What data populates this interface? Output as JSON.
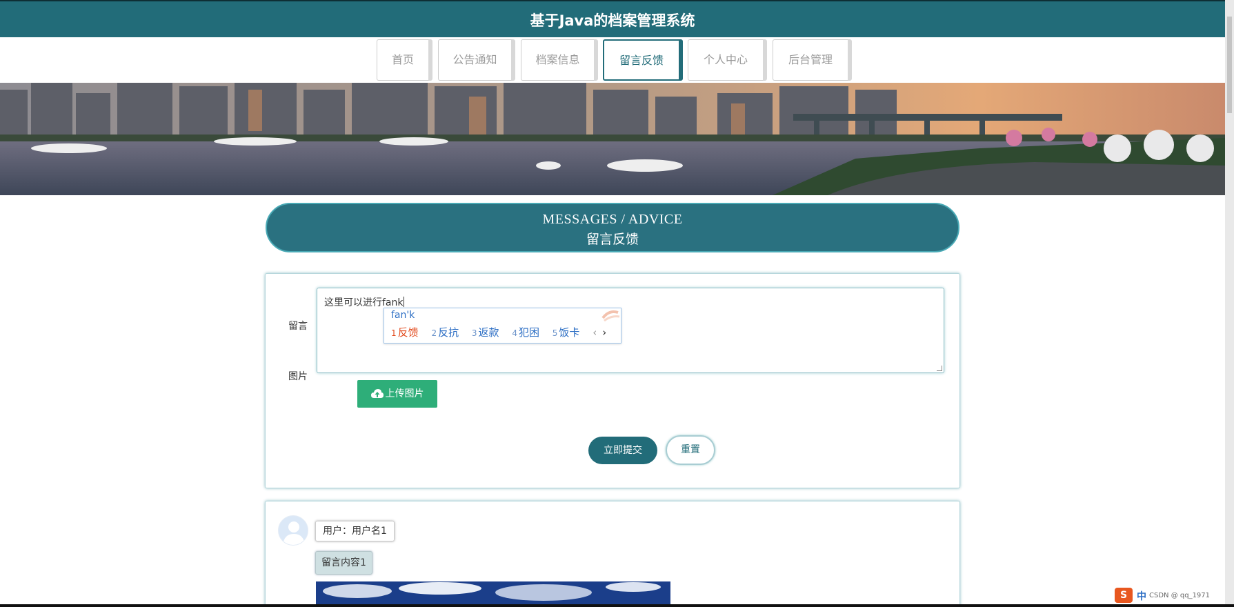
{
  "app_title": "基于Java的档案管理系统",
  "nav": {
    "items": [
      {
        "label": "首页",
        "active": false
      },
      {
        "label": "公告通知",
        "active": false
      },
      {
        "label": "档案信息",
        "active": false
      },
      {
        "label": "留言反馈",
        "active": true
      },
      {
        "label": "个人中心",
        "active": false
      },
      {
        "label": "后台管理",
        "active": false
      }
    ]
  },
  "section": {
    "title_en": "MESSAGES / ADVICE",
    "title_cn": "留言反馈"
  },
  "form": {
    "message_label": "留言",
    "message_value": "这里可以进行fank",
    "image_label": "图片",
    "upload_label": "上传图片",
    "submit_label": "立即提交",
    "reset_label": "重置"
  },
  "ime": {
    "composition": "fan'k",
    "candidates": [
      {
        "num": "1",
        "text": "反馈"
      },
      {
        "num": "2",
        "text": "反抗"
      },
      {
        "num": "3",
        "text": "返款"
      },
      {
        "num": "4",
        "text": "犯困"
      },
      {
        "num": "5",
        "text": "饭卡"
      }
    ],
    "prev": "‹",
    "next": "›"
  },
  "message": {
    "user_label": "用户：用户名1",
    "content": "留言内容1"
  },
  "tray": {
    "lang": "中",
    "watermark": "CSDN @ qq_1971"
  },
  "colors": {
    "primary": "#226c79",
    "upload": "#2eae79",
    "ime_highlight": "#e24a1d"
  }
}
